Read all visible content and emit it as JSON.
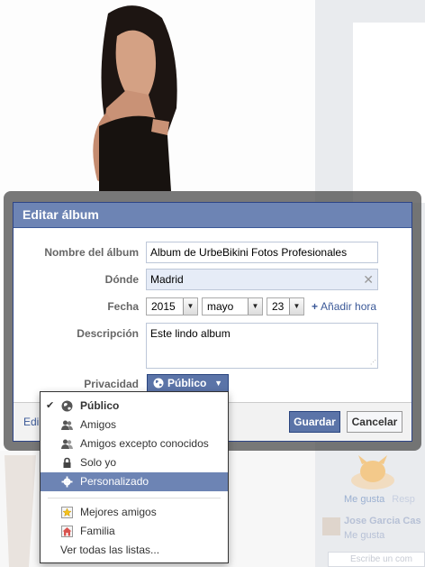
{
  "dialog": {
    "title": "Editar álbum",
    "fields": {
      "name_label": "Nombre del álbum",
      "name_value": "Album de UrbeBikini Fotos Profesionales",
      "where_label": "Dónde",
      "where_value": "Madrid",
      "date_label": "Fecha",
      "year": "2015",
      "month": "mayo",
      "day": "23",
      "add_time": "Añadir hora",
      "description_label": "Descripción",
      "description_value": "Este lindo album",
      "privacy_label": "Privacidad",
      "privacy_value": "Público"
    },
    "footer": {
      "left_link": "Edi",
      "save_label": "Guardar",
      "cancel_label": "Cancelar"
    }
  },
  "privacy_menu": {
    "items": [
      {
        "label": "Público",
        "icon": "globe-icon",
        "checked": true
      },
      {
        "label": "Amigos",
        "icon": "friends-icon"
      },
      {
        "label": "Amigos excepto conocidos",
        "icon": "friends-except-icon"
      },
      {
        "label": "Solo yo",
        "icon": "lock-icon"
      },
      {
        "label": "Personalizado",
        "icon": "gear-icon",
        "highlighted": true
      }
    ],
    "lists": [
      {
        "label": "Mejores amigos",
        "icon": "star-list-icon"
      },
      {
        "label": "Familia",
        "icon": "house-icon"
      }
    ],
    "see_all": "Ver todas las listas..."
  },
  "background": {
    "like_label": "Me gusta",
    "reply_label": "Resp",
    "commenter": "Jose Garcia Cas",
    "write_comment": "Escribe un com"
  },
  "colors": {
    "header_blue": "#6d84b4",
    "button_blue": "#5b74a8",
    "link_blue": "#3b5998"
  }
}
